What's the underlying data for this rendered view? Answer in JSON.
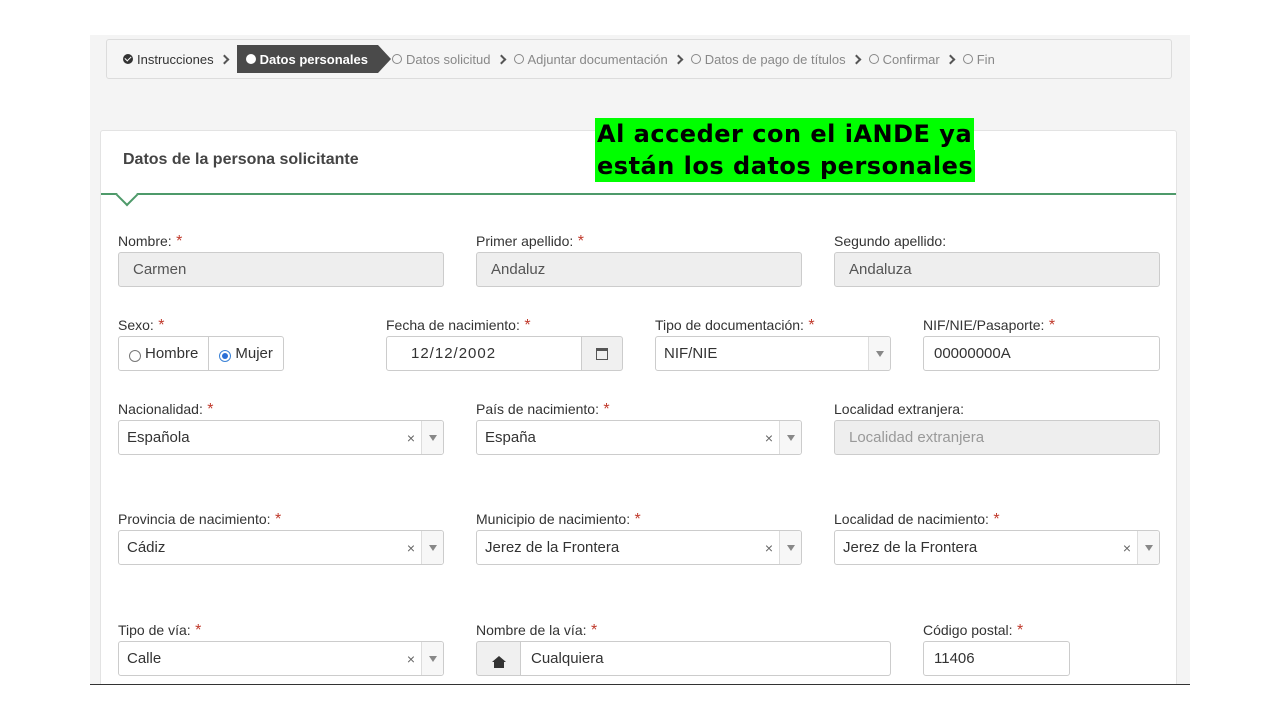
{
  "steps": [
    {
      "label": "Instrucciones",
      "state": "done"
    },
    {
      "label": "Datos personales",
      "state": "active"
    },
    {
      "label": "Datos solicitud",
      "state": "pending"
    },
    {
      "label": "Adjuntar documentación",
      "state": "pending"
    },
    {
      "label": "Datos de pago de títulos",
      "state": "pending"
    },
    {
      "label": "Confirmar",
      "state": "pending"
    },
    {
      "label": "Fin",
      "state": "pending"
    }
  ],
  "card": {
    "title": "Datos de la persona solicitante"
  },
  "banner": {
    "line1": "Al acceder con el iANDE ya ",
    "line2": "están los datos personales"
  },
  "required_mark": "*",
  "fields": {
    "nombre": {
      "label": "Nombre:",
      "value": "Carmen"
    },
    "primer_apellido": {
      "label": "Primer apellido:",
      "value": "Andaluz"
    },
    "segundo_apellido": {
      "label": "Segundo apellido:",
      "value": "Andaluza"
    },
    "sexo": {
      "label": "Sexo:",
      "options": [
        "Hombre",
        "Mujer"
      ],
      "selected": "Mujer"
    },
    "fecha_nacimiento": {
      "label": "Fecha de nacimiento:",
      "value": "12/12/2002"
    },
    "tipo_documentacion": {
      "label": "Tipo de documentación:",
      "value": "NIF/NIE"
    },
    "nif": {
      "label": "NIF/NIE/Pasaporte:",
      "value": "00000000A"
    },
    "nacionalidad": {
      "label": "Nacionalidad:",
      "value": "Española"
    },
    "pais_nacimiento": {
      "label": "País de nacimiento:",
      "value": "España"
    },
    "localidad_extranjera": {
      "label": "Localidad extranjera:",
      "placeholder": "Localidad extranjera"
    },
    "provincia_nacimiento": {
      "label": "Provincia de nacimiento:",
      "value": "Cádiz"
    },
    "municipio_nacimiento": {
      "label": "Municipio de nacimiento:",
      "value": "Jerez de la Frontera"
    },
    "localidad_nacimiento": {
      "label": "Localidad de nacimiento:",
      "value": "Jerez de la Frontera"
    },
    "tipo_via": {
      "label": "Tipo de vía:",
      "value": "Calle"
    },
    "nombre_via": {
      "label": "Nombre de la vía:",
      "value": "Cualquiera"
    },
    "codigo_postal": {
      "label": "Código postal:",
      "value": "11406"
    }
  },
  "icons": {
    "clear": "×",
    "calendar": "calendar-icon",
    "home": "home-icon"
  },
  "colors": {
    "accent_green": "#4e9a6a",
    "banner_bg": "#00ff00",
    "required": "#c0392b",
    "active_step": "#4a4a4a"
  }
}
